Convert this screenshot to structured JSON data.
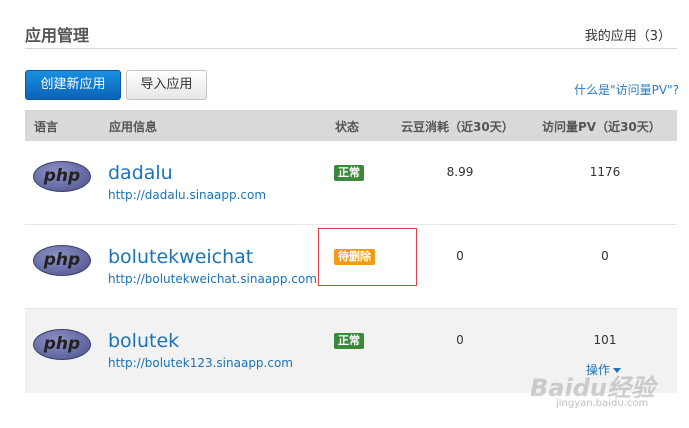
{
  "header": {
    "title": "应用管理",
    "my_apps": "我的应用（3）"
  },
  "toolbar": {
    "create_label": "创建新应用",
    "import_label": "导入应用",
    "pv_help": "什么是\"访问量PV\"?"
  },
  "table": {
    "columns": [
      "语言",
      "应用信息",
      "状态",
      "云豆消耗（近30天）",
      "访问量PV（近30天）"
    ],
    "rows": [
      {
        "language": "php",
        "name": "dadalu",
        "url": "http://dadalu.sinaapp.com",
        "status": "正常",
        "status_color": "#3a8a3a",
        "cost": "8.99",
        "pv": "1176"
      },
      {
        "language": "php",
        "name": "bolutekweichat",
        "url": "http://bolutekweichat.sinaapp.com",
        "status": "待删除",
        "status_color": "#f39c12",
        "cost": "0",
        "pv": "0"
      },
      {
        "language": "php",
        "name": "bolutek",
        "url": "http://bolutek123.sinaapp.com",
        "status": "正常",
        "status_color": "#3a8a3a",
        "cost": "0",
        "pv": "101"
      }
    ],
    "ops_label": "操作"
  },
  "watermark": {
    "main": "Baidu经验",
    "sub": "jingyan.baidu.com"
  }
}
